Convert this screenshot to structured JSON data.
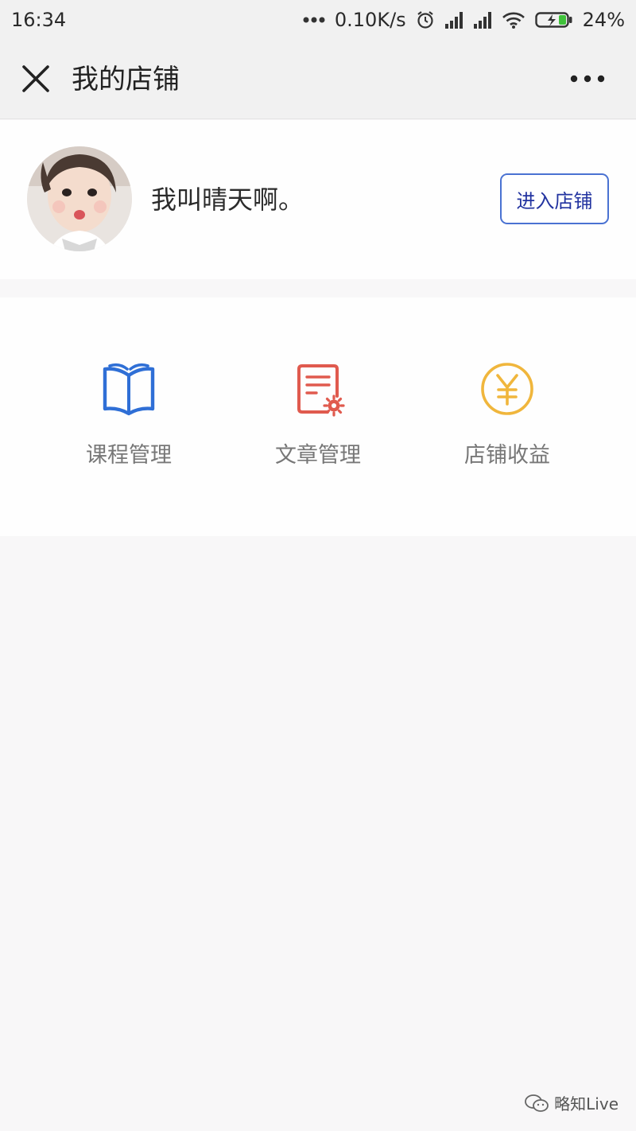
{
  "status_bar": {
    "time": "16:34",
    "network_speed": "0.10K/s",
    "battery": "24%",
    "icons": [
      "more-dots-icon",
      "alarm-icon",
      "signal-icon",
      "signal-icon",
      "wifi-icon",
      "battery-charging-icon"
    ]
  },
  "nav": {
    "title": "我的店铺",
    "close_icon": "close-icon",
    "more_icon": "more-icon"
  },
  "profile": {
    "name": "我叫晴天啊。",
    "enter_button": "进入店铺"
  },
  "menu": [
    {
      "label": "课程管理",
      "icon": "book-icon",
      "color": "#2f6fd6"
    },
    {
      "label": "文章管理",
      "icon": "article-settings-icon",
      "color": "#e05a4e"
    },
    {
      "label": "店铺收益",
      "icon": "yen-icon",
      "color": "#f0b63c"
    }
  ],
  "watermark": {
    "text": "略知Live"
  }
}
